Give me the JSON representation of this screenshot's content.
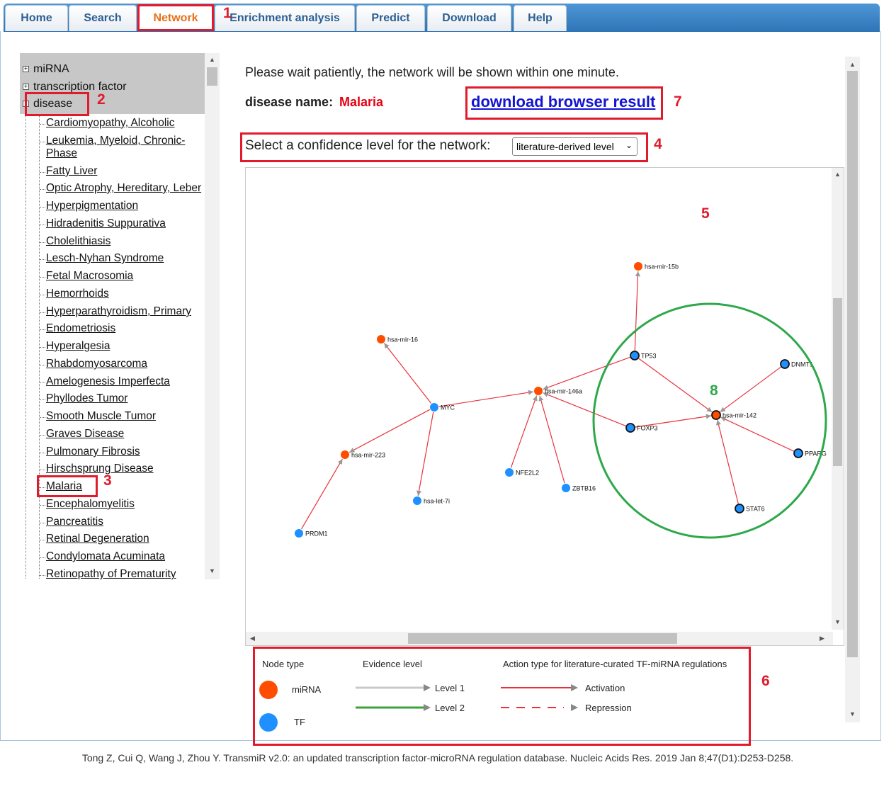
{
  "nav": {
    "tabs": [
      {
        "label": "Home"
      },
      {
        "label": "Search"
      },
      {
        "label": "Network"
      },
      {
        "label": "Enrichment analysis"
      },
      {
        "label": "Predict"
      },
      {
        "label": "Download"
      },
      {
        "label": "Help"
      }
    ],
    "active": "Network"
  },
  "tree": {
    "roots": [
      {
        "label": "miRNA",
        "expander": "+"
      },
      {
        "label": "transcription factor",
        "expander": "+"
      },
      {
        "label": "disease",
        "expander": "-"
      }
    ],
    "diseases": [
      "Cardiomyopathy, Alcoholic",
      "Leukemia, Myeloid, Chronic-",
      "Phase",
      "Fatty Liver",
      "Optic Atrophy, Hereditary, Leber",
      "Hyperpigmentation",
      "Hidradenitis Suppurativa",
      "Cholelithiasis",
      "Lesch-Nyhan Syndrome",
      "Fetal Macrosomia",
      "Hemorrhoids",
      "Hyperparathyroidism, Primary",
      "Endometriosis",
      "Hyperalgesia",
      "Rhabdomyosarcoma",
      "Amelogenesis Imperfecta",
      "Phyllodes Tumor",
      "Smooth Muscle Tumor",
      "Graves Disease",
      "Pulmonary Fibrosis",
      "Hirschsprung Disease",
      "Malaria",
      "Encephalomyelitis",
      "Pancreatitis",
      "Retinal Degeneration",
      "Condylomata Acuminata",
      "Retinopathy of Prematurity"
    ]
  },
  "content": {
    "wait_message": "Please wait patiently, the network will be shown within one minute.",
    "disease_label": "disease name:",
    "disease_value": "Malaria",
    "download_link": "download browser result",
    "confidence_label": "Select a confidence level for the network:",
    "confidence_selected": "literature-derived level"
  },
  "network": {
    "colors": {
      "mirna": "#ff4d00",
      "tf": "#1e90ff",
      "edge": "#e8323c"
    },
    "nodes": [
      {
        "id": "hsa-mir-15b",
        "type": "mirna"
      },
      {
        "id": "hsa-mir-16",
        "type": "mirna"
      },
      {
        "id": "TP53",
        "type": "tf",
        "outlined": true
      },
      {
        "id": "DNMT1",
        "type": "tf",
        "outlined": true,
        "label": "DNMT1"
      },
      {
        "id": "hsa-mir-146a",
        "type": "mirna"
      },
      {
        "id": "MYC",
        "type": "tf"
      },
      {
        "id": "hsa-mir-142",
        "type": "mirna",
        "outlined": true
      },
      {
        "id": "FOXP3",
        "type": "tf",
        "outlined": true
      },
      {
        "id": "PPARG",
        "type": "tf",
        "outlined": true,
        "label": "PPARG"
      },
      {
        "id": "hsa-mir-223",
        "type": "mirna"
      },
      {
        "id": "NFE2L2",
        "type": "tf"
      },
      {
        "id": "ZBTB16",
        "type": "tf"
      },
      {
        "id": "STAT6",
        "type": "tf",
        "outlined": true
      },
      {
        "id": "hsa-let-7i",
        "type": "tf"
      },
      {
        "id": "PRDM1",
        "type": "tf"
      }
    ],
    "edges": [
      [
        "TP53",
        "hsa-mir-15b"
      ],
      [
        "MYC",
        "hsa-mir-16"
      ],
      [
        "MYC",
        "hsa-mir-146a"
      ],
      [
        "MYC",
        "hsa-mir-223"
      ],
      [
        "MYC",
        "hsa-let-7i"
      ],
      [
        "TP53",
        "hsa-mir-146a"
      ],
      [
        "TP53",
        "hsa-mir-142"
      ],
      [
        "DNMT1",
        "hsa-mir-142"
      ],
      [
        "FOXP3",
        "hsa-mir-146a"
      ],
      [
        "FOXP3",
        "hsa-mir-142"
      ],
      [
        "PPARG",
        "hsa-mir-142"
      ],
      [
        "STAT6",
        "hsa-mir-142"
      ],
      [
        "NFE2L2",
        "hsa-mir-146a"
      ],
      [
        "ZBTB16",
        "hsa-mir-146a"
      ],
      [
        "PRDM1",
        "hsa-mir-223"
      ]
    ]
  },
  "legend": {
    "node_type_title": "Node type",
    "node_types": [
      "miRNA",
      "TF"
    ],
    "evidence_title": "Evidence level",
    "evidence_levels": [
      "Level 1",
      "Level 2"
    ],
    "action_title": "Action type for literature-curated TF-miRNA regulations",
    "actions": [
      "Activation",
      "Repression"
    ],
    "colors": {
      "level1": "#c8c8c8",
      "level2": "#3aa33a",
      "activation": "#e8323c"
    }
  },
  "annotations": {
    "numbers": [
      "1",
      "2",
      "3",
      "4",
      "5",
      "6",
      "7",
      "8"
    ],
    "box_color": "#e21b2c",
    "circle_color": "#2ea84a"
  },
  "citation": "Tong Z, Cui Q, Wang J, Zhou Y. TransmiR v2.0: an updated transcription factor-microRNA regulation database. Nucleic Acids Res. 2019 Jan 8;47(D1):D253-D258."
}
